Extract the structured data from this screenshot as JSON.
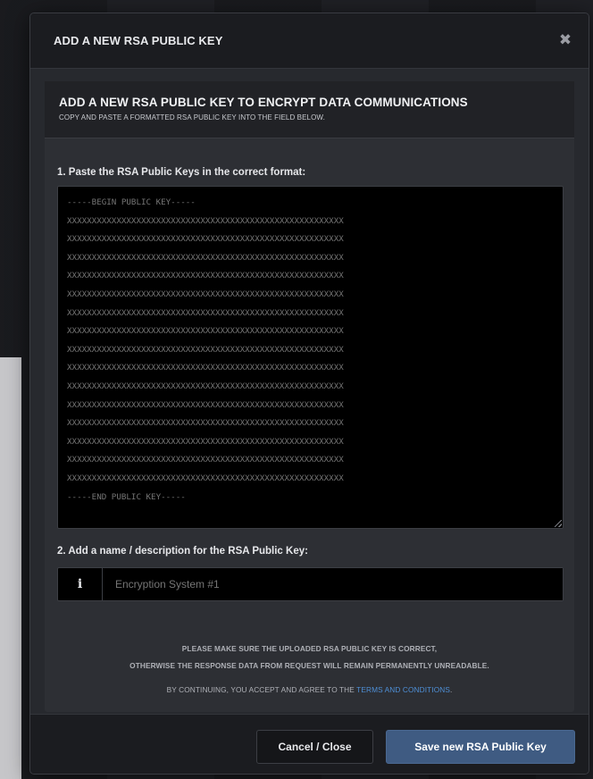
{
  "modal": {
    "title": "ADD A NEW RSA PUBLIC KEY",
    "close_glyph": "✖",
    "close_icon": "close-icon"
  },
  "banner": {
    "title": "ADD A NEW RSA PUBLIC KEY TO ENCRYPT DATA COMMUNICATIONS",
    "subtitle": "COPY AND PASTE A FORMATTED RSA PUBLIC KEY INTO THE FIELD BELOW."
  },
  "key_field": {
    "label": "1. Paste the RSA Public Keys in the correct format:",
    "placeholder": "-----BEGIN PUBLIC KEY-----\nXXXXXXXXXXXXXXXXXXXXXXXXXXXXXXXXXXXXXXXXXXXXXXXXXXXXXXXX\nXXXXXXXXXXXXXXXXXXXXXXXXXXXXXXXXXXXXXXXXXXXXXXXXXXXXXXXX\nXXXXXXXXXXXXXXXXXXXXXXXXXXXXXXXXXXXXXXXXXXXXXXXXXXXXXXXX\nXXXXXXXXXXXXXXXXXXXXXXXXXXXXXXXXXXXXXXXXXXXXXXXXXXXXXXXX\nXXXXXXXXXXXXXXXXXXXXXXXXXXXXXXXXXXXXXXXXXXXXXXXXXXXXXXXX\nXXXXXXXXXXXXXXXXXXXXXXXXXXXXXXXXXXXXXXXXXXXXXXXXXXXXXXXX\nXXXXXXXXXXXXXXXXXXXXXXXXXXXXXXXXXXXXXXXXXXXXXXXXXXXXXXXX\nXXXXXXXXXXXXXXXXXXXXXXXXXXXXXXXXXXXXXXXXXXXXXXXXXXXXXXXX\nXXXXXXXXXXXXXXXXXXXXXXXXXXXXXXXXXXXXXXXXXXXXXXXXXXXXXXXX\nXXXXXXXXXXXXXXXXXXXXXXXXXXXXXXXXXXXXXXXXXXXXXXXXXXXXXXXX\nXXXXXXXXXXXXXXXXXXXXXXXXXXXXXXXXXXXXXXXXXXXXXXXXXXXXXXXX\nXXXXXXXXXXXXXXXXXXXXXXXXXXXXXXXXXXXXXXXXXXXXXXXXXXXXXXXX\nXXXXXXXXXXXXXXXXXXXXXXXXXXXXXXXXXXXXXXXXXXXXXXXXXXXXXXXX\nXXXXXXXXXXXXXXXXXXXXXXXXXXXXXXXXXXXXXXXXXXXXXXXXXXXXXXXX\nXXXXXXXXXXXXXXXXXXXXXXXXXXXXXXXXXXXXXXXXXXXXXXXXXXXXXXXX\n-----END PUBLIC KEY-----",
    "value": ""
  },
  "name_field": {
    "label": "2. Add a name / description for the RSA Public Key:",
    "icon": "info-icon",
    "icon_glyph": "i",
    "placeholder": "Encryption System #1",
    "value": ""
  },
  "notice": {
    "line1": "PLEASE MAKE SURE THE UPLOADED RSA PUBLIC KEY IS CORRECT,",
    "line2": "OTHERWISE THE RESPONSE DATA FROM REQUEST WILL REMAIN PERMANENTLY UNREADABLE."
  },
  "terms": {
    "prefix": "BY CONTINUING, YOU ACCEPT AND AGREE TO THE ",
    "link": "TERMS AND CONDITIONS",
    "suffix": "."
  },
  "footer": {
    "cancel_label": "Cancel / Close",
    "save_label": "Save new RSA Public Key"
  },
  "colors": {
    "accent_link": "#4e8fd6",
    "primary_button": "#3f5b82",
    "modal_background": "#27292e",
    "header_background": "#1b1c20"
  }
}
